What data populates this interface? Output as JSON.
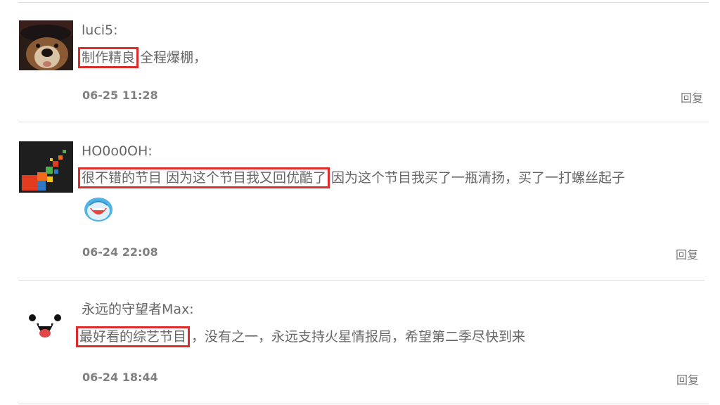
{
  "comments": [
    {
      "username": "luci5:",
      "highlight": "制作精良",
      "rest": "全程爆棚，",
      "time": "06-25 11:28",
      "reply_label": "回复",
      "avatar_icon": "dog-avatar-icon"
    },
    {
      "username": "HO0o0OH:",
      "highlight": "很不错的节目 因为这个节目我又回优酷了",
      "rest": "因为这个节目我买了一瓶清扬，买了一打螺丝起子",
      "emoji_icon": "laughing-face-emoji-icon",
      "time": "06-24 22:08",
      "reply_label": "回复",
      "avatar_icon": "pixel-blocks-avatar-icon"
    },
    {
      "username": "永远的守望者Max:",
      "highlight": "最好看的综艺节目",
      "rest": "，没有之一，永远支持火星情报局，希望第二季尽快到来",
      "time": "06-24 18:44",
      "reply_label": "回复",
      "avatar_icon": "smiley-face-avatar-icon"
    }
  ],
  "colors": {
    "highlight_border": "#e02b2b",
    "divider": "#dddddd",
    "text": "#666666"
  }
}
